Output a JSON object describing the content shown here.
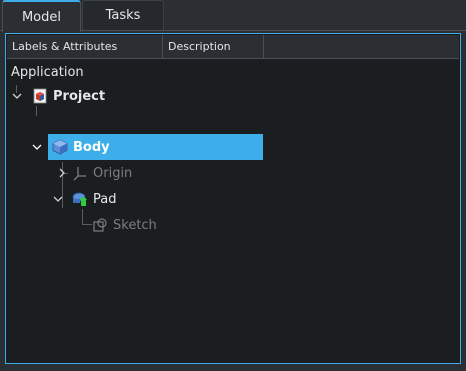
{
  "tabs": [
    {
      "label": "Model",
      "active": true
    },
    {
      "label": "Tasks",
      "active": false
    }
  ],
  "columns": [
    "Labels & Attributes",
    "Description"
  ],
  "tree": {
    "root_label": "Application",
    "items": [
      {
        "label": "Project",
        "icon": "project-document-icon",
        "expanded": true
      },
      {
        "label": "Body",
        "icon": "body-icon",
        "expanded": true,
        "selected": true
      },
      {
        "label": "Origin",
        "icon": "origin-axes-icon",
        "expanded": false,
        "dimmed": true
      },
      {
        "label": "Pad",
        "icon": "pad-icon",
        "expanded": true
      },
      {
        "label": "Sketch",
        "icon": "sketch-icon",
        "dimmed": true
      }
    ]
  },
  "colors": {
    "accent": "#3daee9",
    "background": "#1b1e20",
    "text": "#e6e6e6",
    "dim_text": "#7a7d81"
  }
}
